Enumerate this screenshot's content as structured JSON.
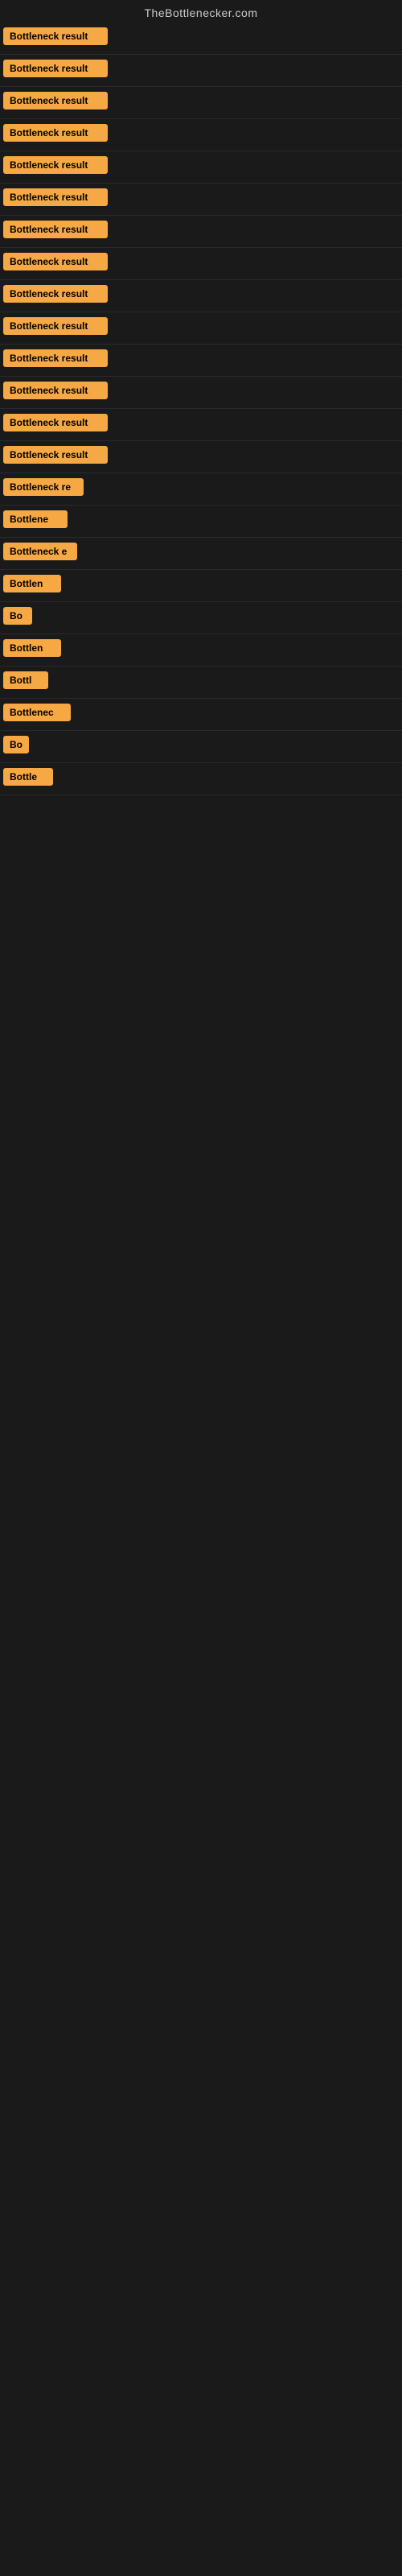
{
  "site": {
    "title": "TheBottlenecker.com"
  },
  "colors": {
    "badge_bg": "#f5a843",
    "badge_text": "#000000",
    "page_bg": "#1a1a1a"
  },
  "rows": [
    {
      "id": 1,
      "label": "Bottleneck result",
      "width": 130
    },
    {
      "id": 2,
      "label": "Bottleneck result",
      "width": 130
    },
    {
      "id": 3,
      "label": "Bottleneck result",
      "width": 130
    },
    {
      "id": 4,
      "label": "Bottleneck result",
      "width": 130
    },
    {
      "id": 5,
      "label": "Bottleneck result",
      "width": 130
    },
    {
      "id": 6,
      "label": "Bottleneck result",
      "width": 130
    },
    {
      "id": 7,
      "label": "Bottleneck result",
      "width": 130
    },
    {
      "id": 8,
      "label": "Bottleneck result",
      "width": 130
    },
    {
      "id": 9,
      "label": "Bottleneck result",
      "width": 130
    },
    {
      "id": 10,
      "label": "Bottleneck result",
      "width": 130
    },
    {
      "id": 11,
      "label": "Bottleneck result",
      "width": 130
    },
    {
      "id": 12,
      "label": "Bottleneck result",
      "width": 130
    },
    {
      "id": 13,
      "label": "Bottleneck result",
      "width": 130
    },
    {
      "id": 14,
      "label": "Bottleneck result",
      "width": 130
    },
    {
      "id": 15,
      "label": "Bottleneck re",
      "width": 100
    },
    {
      "id": 16,
      "label": "Bottlene",
      "width": 80
    },
    {
      "id": 17,
      "label": "Bottleneck e",
      "width": 92
    },
    {
      "id": 18,
      "label": "Bottlen",
      "width": 72
    },
    {
      "id": 19,
      "label": "Bo",
      "width": 36
    },
    {
      "id": 20,
      "label": "Bottlen",
      "width": 72
    },
    {
      "id": 21,
      "label": "Bottl",
      "width": 56
    },
    {
      "id": 22,
      "label": "Bottlenec",
      "width": 84
    },
    {
      "id": 23,
      "label": "Bo",
      "width": 32
    },
    {
      "id": 24,
      "label": "Bottle",
      "width": 62
    }
  ]
}
